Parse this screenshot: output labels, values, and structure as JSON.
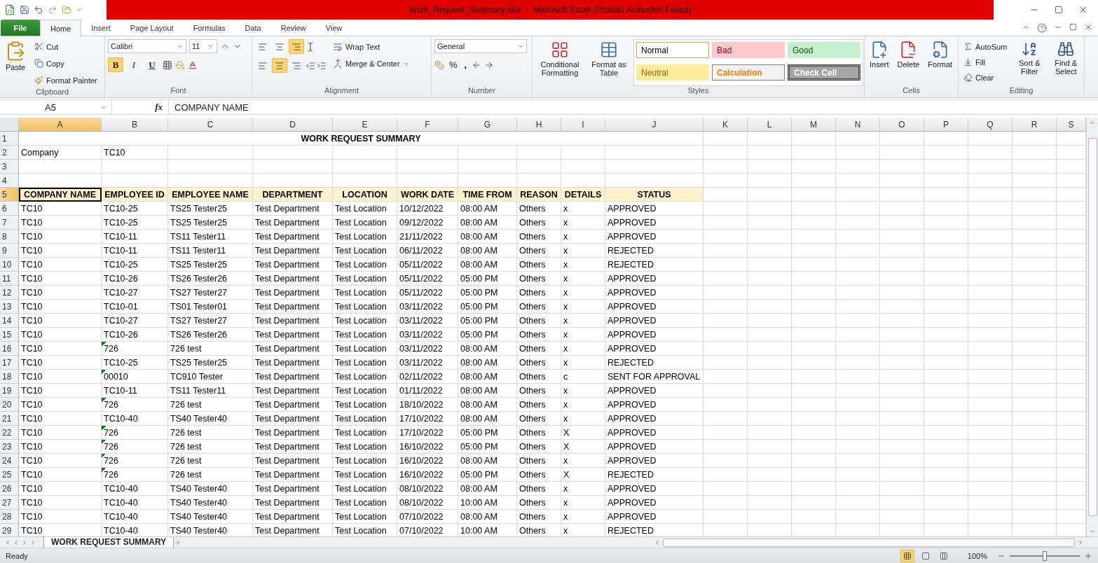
{
  "title_bar": {
    "title": "Work_Request_Summary.xlsx  -  Microsoft Excel (Product Activation Failed)"
  },
  "ribbon_tabs": [
    {
      "label": "File",
      "kind": "file",
      "selected": false
    },
    {
      "label": "Home",
      "kind": "tab",
      "selected": true
    },
    {
      "label": "Insert",
      "kind": "tab",
      "selected": false
    },
    {
      "label": "Page Layout",
      "kind": "tab",
      "selected": false
    },
    {
      "label": "Formulas",
      "kind": "tab",
      "selected": false
    },
    {
      "label": "Data",
      "kind": "tab",
      "selected": false
    },
    {
      "label": "Review",
      "kind": "tab",
      "selected": false
    },
    {
      "label": "View",
      "kind": "tab",
      "selected": false
    }
  ],
  "clipboard": {
    "label": "Clipboard",
    "paste": "Paste",
    "cut": "Cut",
    "copy": "Copy",
    "format_painter": "Format Painter"
  },
  "font": {
    "label": "Font",
    "name": "Calibri",
    "size": "11",
    "bold": {
      "text": "B",
      "selected": true
    },
    "italic": {
      "text": "I",
      "selected": false
    },
    "underline": {
      "text": "U",
      "selected": false
    }
  },
  "alignment": {
    "label": "Alignment",
    "wrap_text": "Wrap Text",
    "merge_center": "Merge & Center",
    "vertical": [
      {
        "kind": "top",
        "selected": false
      },
      {
        "kind": "middle",
        "selected": false
      },
      {
        "kind": "bottom",
        "selected": true
      }
    ],
    "horizontal": [
      {
        "kind": "left",
        "selected": false
      },
      {
        "kind": "center",
        "selected": true
      },
      {
        "kind": "right",
        "selected": false
      }
    ]
  },
  "number": {
    "label": "Number",
    "format": "General",
    "percent": "%",
    "comma": ","
  },
  "styles": {
    "label": "Styles",
    "conditional": "Conditional Formatting",
    "format_table": "Format as Table",
    "cells": [
      {
        "text": "Normal",
        "kind": "normal"
      },
      {
        "text": "Bad",
        "kind": "bad"
      },
      {
        "text": "Good",
        "kind": "good"
      },
      {
        "text": "Neutral",
        "kind": "neutral"
      },
      {
        "text": "Calculation",
        "kind": "calculation"
      },
      {
        "text": "Check Cell",
        "kind": "check"
      }
    ]
  },
  "cells_group": {
    "label": "Cells",
    "insert": "Insert",
    "delete": "Delete",
    "format": "Format"
  },
  "editing": {
    "label": "Editing",
    "autosum": "AutoSum",
    "fill": "Fill",
    "clear": "Clear",
    "sort": "Sort & Filter",
    "find": "Find & Select"
  },
  "formula_bar": {
    "name_box": "A5",
    "fx": "fx",
    "value": "COMPANY NAME"
  },
  "columns": [
    {
      "label": "A",
      "selected": true
    },
    {
      "label": "B",
      "selected": false
    },
    {
      "label": "C",
      "selected": false
    },
    {
      "label": "D",
      "selected": false
    },
    {
      "label": "E",
      "selected": false
    },
    {
      "label": "F",
      "selected": false
    },
    {
      "label": "G",
      "selected": false
    },
    {
      "label": "H",
      "selected": false
    },
    {
      "label": "I",
      "selected": false
    },
    {
      "label": "J",
      "selected": false
    },
    {
      "label": "K",
      "selected": false
    },
    {
      "label": "L",
      "selected": false
    },
    {
      "label": "M",
      "selected": false
    },
    {
      "label": "N",
      "selected": false
    },
    {
      "label": "O",
      "selected": false
    },
    {
      "label": "P",
      "selected": false
    },
    {
      "label": "Q",
      "selected": false
    },
    {
      "label": "R",
      "selected": false
    },
    {
      "label": "S",
      "selected": false
    }
  ],
  "title_row": {
    "n": "1",
    "text": "WORK REQUEST SUMMARY"
  },
  "company_row": {
    "n": "2",
    "cells": [
      "Company",
      "TC10"
    ]
  },
  "blank_rows": [
    "3",
    "4"
  ],
  "header_row": {
    "n": "5",
    "cells": [
      {
        "text": "COMPANY NAME",
        "selected": true
      },
      {
        "text": "EMPLOYEE ID",
        "selected": false
      },
      {
        "text": "EMPLOYEE NAME",
        "selected": false
      },
      {
        "text": "DEPARTMENT",
        "selected": false
      },
      {
        "text": "LOCATION",
        "selected": false
      },
      {
        "text": "WORK DATE",
        "selected": false
      },
      {
        "text": "TIME FROM",
        "selected": false
      },
      {
        "text": "REASON",
        "selected": false
      },
      {
        "text": "DETAILS",
        "selected": false
      },
      {
        "text": "STATUS",
        "selected": false
      }
    ]
  },
  "rows": [
    {
      "n": "6",
      "flag": false,
      "cells": [
        "TC10",
        "TC10-25",
        "TS25 Tester25",
        "Test Department",
        "Test Location",
        "10/12/2022",
        "08:00 AM",
        "Others",
        "x",
        "APPROVED"
      ]
    },
    {
      "n": "7",
      "flag": false,
      "cells": [
        "TC10",
        "TC10-25",
        "TS25 Tester25",
        "Test Department",
        "Test Location",
        "09/12/2022",
        "08:00 AM",
        "Others",
        "x",
        "APPROVED"
      ]
    },
    {
      "n": "8",
      "flag": false,
      "cells": [
        "TC10",
        "TC10-11",
        "TS11 Tester11",
        "Test Department",
        "Test Location",
        "21/11/2022",
        "08:00 AM",
        "Others",
        "x",
        "APPROVED"
      ]
    },
    {
      "n": "9",
      "flag": false,
      "cells": [
        "TC10",
        "TC10-11",
        "TS11 Tester11",
        "Test Department",
        "Test Location",
        "06/11/2022",
        "08:00 AM",
        "Others",
        "x",
        "REJECTED"
      ]
    },
    {
      "n": "10",
      "flag": false,
      "cells": [
        "TC10",
        "TC10-25",
        "TS25 Tester25",
        "Test Department",
        "Test Location",
        "05/11/2022",
        "08:00 AM",
        "Others",
        "x",
        "REJECTED"
      ]
    },
    {
      "n": "11",
      "flag": false,
      "cells": [
        "TC10",
        "TC10-26",
        "TS26 Tester26",
        "Test Department",
        "Test Location",
        "05/11/2022",
        "05:00 PM",
        "Others",
        "x",
        "APPROVED"
      ]
    },
    {
      "n": "12",
      "flag": false,
      "cells": [
        "TC10",
        "TC10-27",
        "TS27 Tester27",
        "Test Department",
        "Test Location",
        "05/11/2022",
        "05:00 PM",
        "Others",
        "x",
        "APPROVED"
      ]
    },
    {
      "n": "13",
      "flag": false,
      "cells": [
        "TC10",
        "TC10-01",
        "TS01 Tester01",
        "Test Department",
        "Test Location",
        "03/11/2022",
        "05:00 PM",
        "Others",
        "x",
        "APPROVED"
      ]
    },
    {
      "n": "14",
      "flag": false,
      "cells": [
        "TC10",
        "TC10-27",
        "TS27 Tester27",
        "Test Department",
        "Test Location",
        "03/11/2022",
        "05:00 PM",
        "Others",
        "x",
        "APPROVED"
      ]
    },
    {
      "n": "15",
      "flag": false,
      "cells": [
        "TC10",
        "TC10-26",
        "TS26 Tester26",
        "Test Department",
        "Test Location",
        "03/11/2022",
        "05:00 PM",
        "Others",
        "x",
        "APPROVED"
      ]
    },
    {
      "n": "16",
      "flag": true,
      "cells": [
        "TC10",
        "726",
        "726 test",
        "Test Department",
        "Test Location",
        "03/11/2022",
        "08:00 AM",
        "Others",
        "x",
        "APPROVED"
      ]
    },
    {
      "n": "17",
      "flag": false,
      "cells": [
        "TC10",
        "TC10-25",
        "TS25 Tester25",
        "Test Department",
        "Test Location",
        "03/11/2022",
        "08:00 AM",
        "Others",
        "x",
        "REJECTED"
      ]
    },
    {
      "n": "18",
      "flag": true,
      "cells": [
        "TC10",
        "00010",
        "TC910 Tester",
        "Test Department",
        "Test Location",
        "02/11/2022",
        "08:00 AM",
        "Others",
        "c",
        "SENT FOR APPROVAL"
      ]
    },
    {
      "n": "19",
      "flag": false,
      "cells": [
        "TC10",
        "TC10-11",
        "TS11 Tester11",
        "Test Department",
        "Test Location",
        "01/11/2022",
        "08:00 AM",
        "Others",
        "x",
        "APPROVED"
      ]
    },
    {
      "n": "20",
      "flag": true,
      "cells": [
        "TC10",
        "726",
        "726 test",
        "Test Department",
        "Test Location",
        "18/10/2022",
        "08:00 AM",
        "Others",
        "x",
        "APPROVED"
      ]
    },
    {
      "n": "21",
      "flag": false,
      "cells": [
        "TC10",
        "TC10-40",
        "TS40 Tester40",
        "Test Department",
        "Test Location",
        "17/10/2022",
        "08:00 AM",
        "Others",
        "x",
        "APPROVED"
      ]
    },
    {
      "n": "22",
      "flag": true,
      "cells": [
        "TC10",
        "726",
        "726 test",
        "Test Department",
        "Test Location",
        "17/10/2022",
        "05:00 PM",
        "Others",
        "X",
        "APPROVED"
      ]
    },
    {
      "n": "23",
      "flag": true,
      "cells": [
        "TC10",
        "726",
        "726 test",
        "Test Department",
        "Test Location",
        "16/10/2022",
        "05:00 PM",
        "Others",
        "X",
        "APPROVED"
      ]
    },
    {
      "n": "24",
      "flag": true,
      "cells": [
        "TC10",
        "726",
        "726 test",
        "Test Department",
        "Test Location",
        "16/10/2022",
        "08:00 AM",
        "Others",
        "x",
        "APPROVED"
      ]
    },
    {
      "n": "25",
      "flag": true,
      "cells": [
        "TC10",
        "726",
        "726 test",
        "Test Department",
        "Test Location",
        "16/10/2022",
        "05:00 PM",
        "Others",
        "X",
        "REJECTED"
      ]
    },
    {
      "n": "26",
      "flag": false,
      "cells": [
        "TC10",
        "TC10-40",
        "TS40 Tester40",
        "Test Department",
        "Test Location",
        "08/10/2022",
        "08:00 AM",
        "Others",
        "x",
        "APPROVED"
      ]
    },
    {
      "n": "27",
      "flag": false,
      "cells": [
        "TC10",
        "TC10-40",
        "TS40 Tester40",
        "Test Department",
        "Test Location",
        "08/10/2022",
        "10:00 AM",
        "Others",
        "x",
        "APPROVED"
      ]
    },
    {
      "n": "28",
      "flag": false,
      "cells": [
        "TC10",
        "TC10-40",
        "TS40 Tester40",
        "Test Department",
        "Test Location",
        "07/10/2022",
        "08:00 AM",
        "Others",
        "x",
        "APPROVED"
      ]
    },
    {
      "n": "29",
      "flag": false,
      "cells": [
        "TC10",
        "TC10-40",
        "TS40 Tester40",
        "Test Department",
        "Test Location",
        "07/10/2022",
        "10:00 AM",
        "Others",
        "x",
        "REJECTED"
      ]
    }
  ],
  "sheet_tabs": [
    {
      "label": "WORK REQUEST SUMMARY",
      "selected": true
    }
  ],
  "status_bar": {
    "status": "Ready",
    "zoom": "100%",
    "zoom_level": {
      "level": 0.5
    },
    "views": [
      {
        "kind": "normal",
        "selected": true
      },
      {
        "kind": "page_layout",
        "selected": false
      },
      {
        "kind": "page_break",
        "selected": false
      }
    ]
  }
}
